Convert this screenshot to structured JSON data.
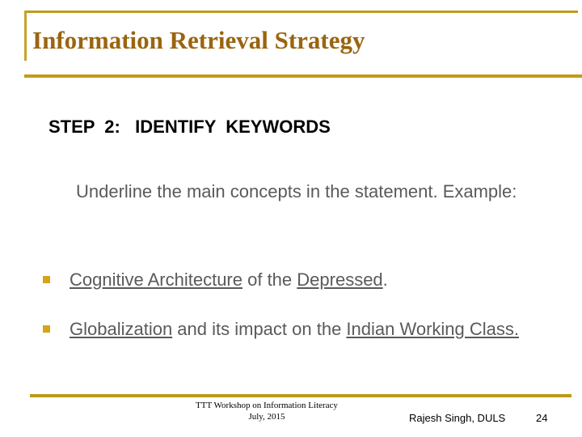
{
  "slide": {
    "title": "Information Retrieval Strategy",
    "accent_color": "#c19a1e",
    "title_color": "#9a6510",
    "body_color": "#5a5a5a",
    "bullet_color": "#d5a419",
    "background_color": "#ffffff"
  },
  "body": {
    "step_heading": "STEP  2:   IDENTIFY  KEYWORDS",
    "intro_paragraph": "Underline the main concepts in the statement. Example:",
    "bullets": [
      {
        "marker": "square-bullet",
        "segments": [
          {
            "text": "Cognitive Architecture",
            "underline": true
          },
          {
            "text": " of the ",
            "underline": false
          },
          {
            "text": "Depressed",
            "underline": true
          },
          {
            "text": ".",
            "underline": false
          }
        ]
      },
      {
        "marker": "square-bullet",
        "segments": [
          {
            "text": "Globalization",
            "underline": true
          },
          {
            "text": " and its impact on the ",
            "underline": false
          },
          {
            "text": "Indian Working Class.",
            "underline": true
          }
        ]
      }
    ]
  },
  "footer": {
    "event_line1": "TTT Workshop on Information Literacy",
    "event_line2": "July, 2015",
    "author": "Rajesh Singh, DULS",
    "slide_number": "24"
  }
}
